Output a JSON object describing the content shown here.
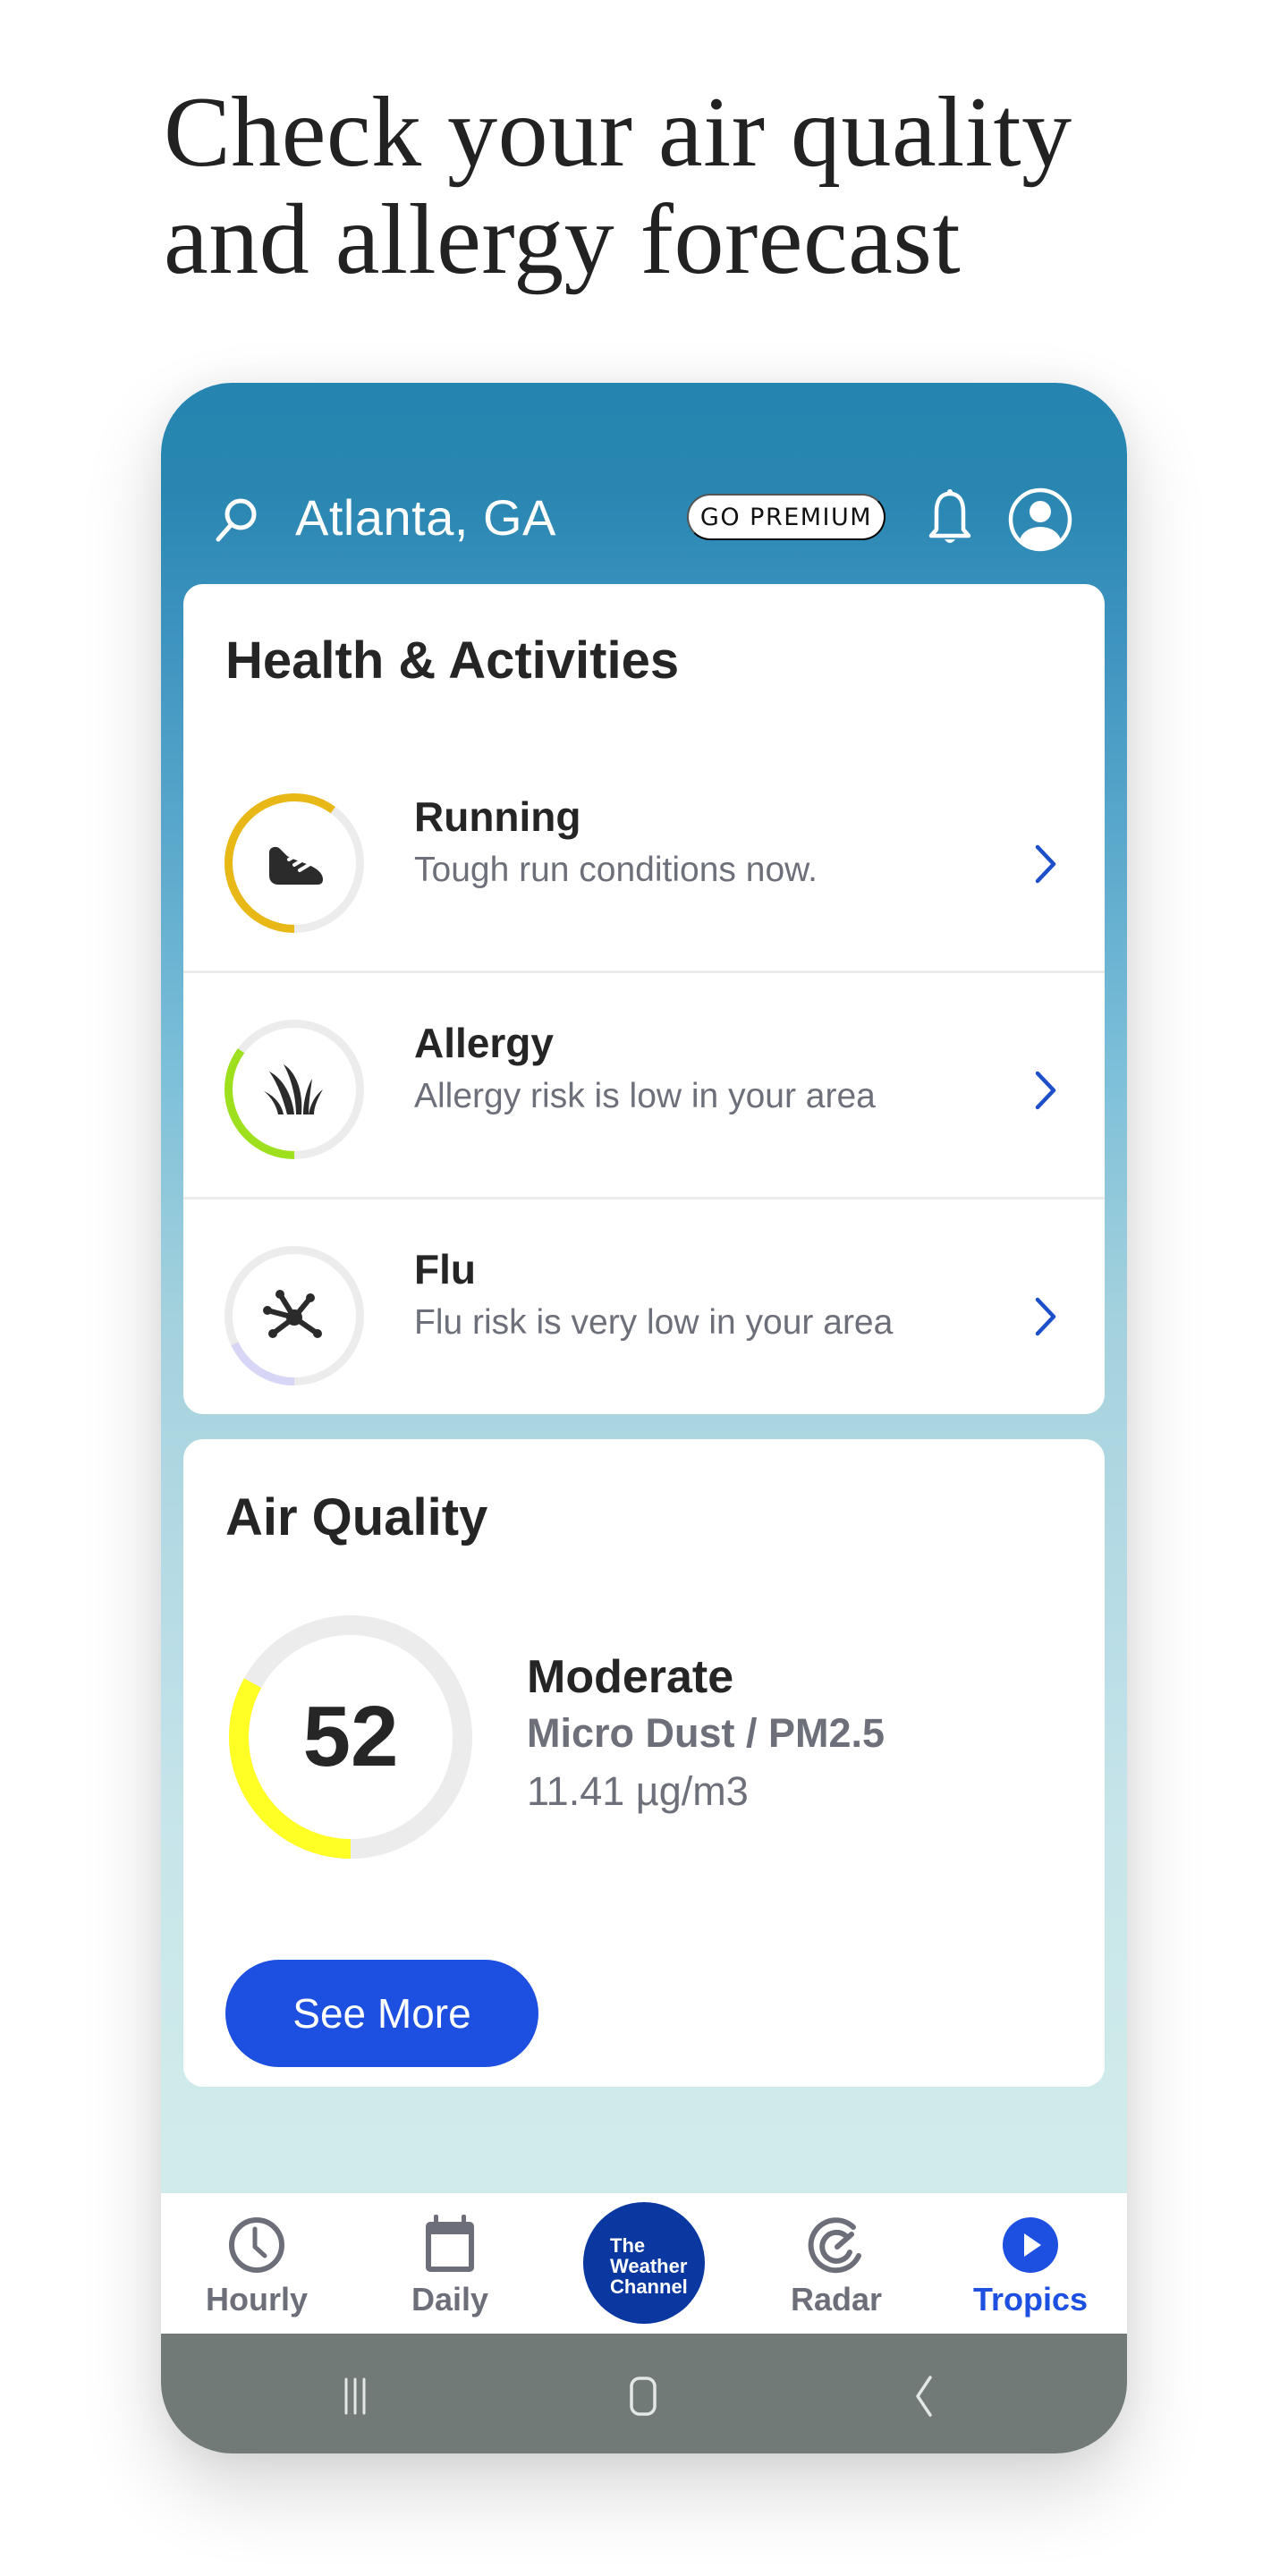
{
  "headline": {
    "line1": "Check your air quality",
    "line2": "and allergy forecast"
  },
  "header": {
    "location": "Atlanta, GA",
    "premium_label": "GO PREMIUM",
    "icons": [
      "search-icon",
      "bell-icon",
      "profile-icon"
    ]
  },
  "health": {
    "title": "Health & Activities",
    "items": [
      {
        "title": "Running",
        "subtitle": "Tough run conditions now.",
        "icon": "running-shoe-icon",
        "level": 0.6,
        "color": "#e8b816"
      },
      {
        "title": "Allergy",
        "subtitle": "Allergy risk is low in your area",
        "icon": "grass-icon",
        "level": 0.35,
        "color": "#9fe01e"
      },
      {
        "title": "Flu",
        "subtitle": "Flu risk is very low in your area",
        "icon": "virus-icon",
        "level": 0.18,
        "color": "#d8d6f7"
      }
    ]
  },
  "air_quality": {
    "title": "Air Quality",
    "index": "52",
    "level_fraction": 0.33,
    "color": "#ffff26",
    "category": "Moderate",
    "pollutant": "Micro Dust / PM2.5",
    "concentration": "11.41 µg/m3",
    "button_label": "See More"
  },
  "bottom_nav": {
    "items": [
      {
        "label": "Hourly",
        "icon": "clock-icon",
        "active": false
      },
      {
        "label": "Daily",
        "icon": "calendar-icon",
        "active": false
      },
      {
        "label": "Radar",
        "icon": "radar-icon",
        "active": false
      },
      {
        "label": "Tropics",
        "icon": "play-circle-icon",
        "active": true
      }
    ],
    "logo": [
      "The",
      "Weather",
      "Channel"
    ]
  },
  "system_nav": {
    "buttons": [
      "recents",
      "home",
      "back"
    ]
  },
  "colors": {
    "accent": "#1d4fe0",
    "logo_blue": "#0a38a0",
    "header_blue": "#2685b0",
    "system_nav": "#717a76"
  }
}
